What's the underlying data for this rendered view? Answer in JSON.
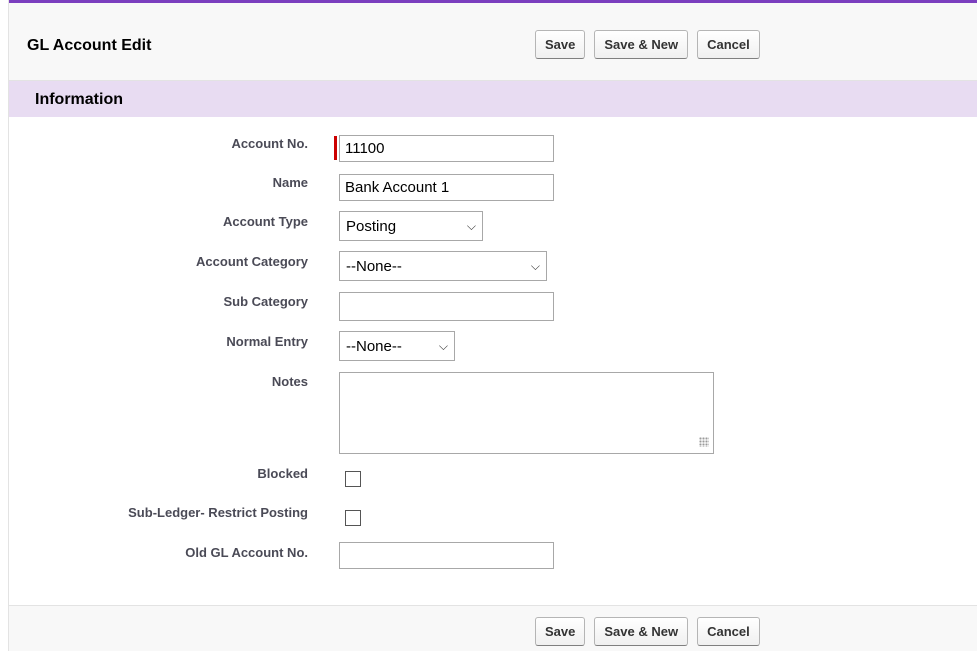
{
  "header": {
    "title": "GL Account Edit",
    "buttons": {
      "save": "Save",
      "save_new": "Save & New",
      "cancel": "Cancel"
    }
  },
  "section": {
    "title": "Information"
  },
  "fields": {
    "account_no": {
      "label": "Account No.",
      "value": "11100",
      "required": true
    },
    "name": {
      "label": "Name",
      "value": "Bank Account 1"
    },
    "account_type": {
      "label": "Account Type",
      "selected": "Posting"
    },
    "account_category": {
      "label": "Account Category",
      "selected": "--None--"
    },
    "sub_category": {
      "label": "Sub Category",
      "value": ""
    },
    "normal_entry": {
      "label": "Normal Entry",
      "selected": "--None--"
    },
    "notes": {
      "label": "Notes",
      "value": ""
    },
    "blocked": {
      "label": "Blocked",
      "checked": false
    },
    "sub_ledger": {
      "label": "Sub-Ledger- Restrict Posting",
      "checked": false
    },
    "old_gl_account_no": {
      "label": "Old GL Account No.",
      "value": ""
    }
  },
  "footer": {
    "buttons": {
      "save": "Save",
      "save_new": "Save & New",
      "cancel": "Cancel"
    }
  },
  "colors": {
    "accent": "#7b3fbf",
    "section_bg": "#e8dcf2",
    "required": "#cc0000"
  },
  "icons": {
    "dropdown": "chevron-down-icon",
    "resize": "resize-grip-icon"
  }
}
